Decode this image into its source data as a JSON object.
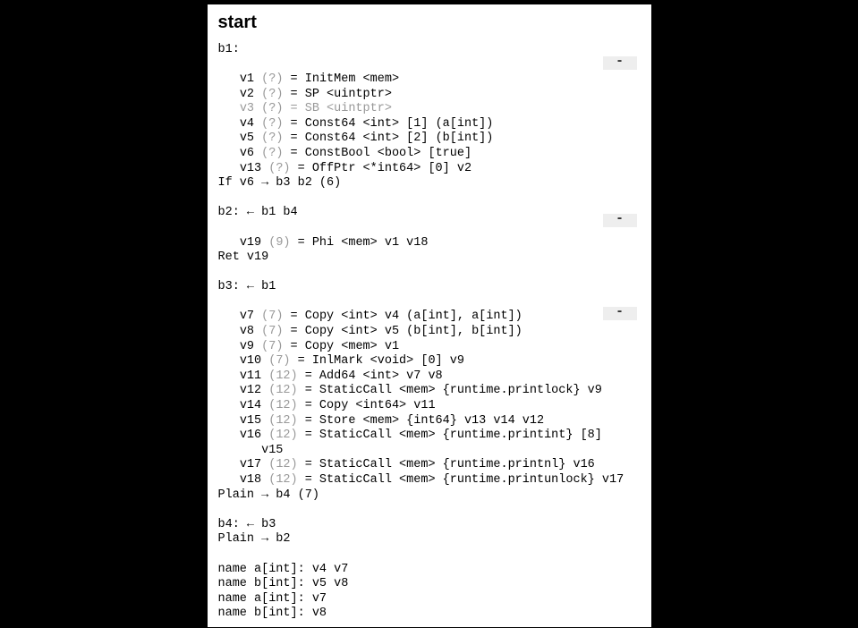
{
  "title": "start",
  "collapse_label": "-",
  "blocks": {
    "b1": {
      "header": "b1:",
      "lines": [
        {
          "indent": "   ",
          "pre": "v1 ",
          "dim": "(?)",
          "post": " = InitMem <mem>"
        },
        {
          "indent": "   ",
          "pre": "v2 ",
          "dim": "(?)",
          "post": " = SP <uintptr>"
        },
        {
          "indent": "   ",
          "pre": "",
          "dim": "v3 (?) = SB <uintptr>",
          "post": ""
        },
        {
          "indent": "   ",
          "pre": "v4 ",
          "dim": "(?)",
          "post": " = Const64 <int> [1] (a[int])"
        },
        {
          "indent": "   ",
          "pre": "v5 ",
          "dim": "(?)",
          "post": " = Const64 <int> [2] (b[int])"
        },
        {
          "indent": "   ",
          "pre": "v6 ",
          "dim": "(?)",
          "post": " = ConstBool <bool> [true]"
        },
        {
          "indent": "   ",
          "pre": "v13 ",
          "dim": "(?)",
          "post": " = OffPtr <*int64> [0] v2"
        }
      ],
      "footer": "If v6 → b3 b2 (6)"
    },
    "b2": {
      "header": "b2: ← b1 b4",
      "lines": [
        {
          "indent": "   ",
          "pre": "v19 ",
          "dim": "(9)",
          "post": " = Phi <mem> v1 v18"
        }
      ],
      "footer": "Ret v19"
    },
    "b3": {
      "header": "b3: ← b1",
      "lines": [
        {
          "indent": "   ",
          "pre": "v7 ",
          "dim": "(7)",
          "post": " = Copy <int> v4 (a[int], a[int])"
        },
        {
          "indent": "   ",
          "pre": "v8 ",
          "dim": "(7)",
          "post": " = Copy <int> v5 (b[int], b[int])"
        },
        {
          "indent": "   ",
          "pre": "v9 ",
          "dim": "(7)",
          "post": " = Copy <mem> v1"
        },
        {
          "indent": "   ",
          "pre": "v10 ",
          "dim": "(7)",
          "post": " = InlMark <void> [0] v9"
        },
        {
          "indent": "   ",
          "pre": "v11 ",
          "dim": "(12)",
          "post": " = Add64 <int> v7 v8"
        },
        {
          "indent": "   ",
          "pre": "v12 ",
          "dim": "(12)",
          "post": " = StaticCall <mem> {runtime.printlock} v9"
        },
        {
          "indent": "   ",
          "pre": "v14 ",
          "dim": "(12)",
          "post": " = Copy <int64> v11"
        },
        {
          "indent": "   ",
          "pre": "v15 ",
          "dim": "(12)",
          "post": " = Store <mem> {int64} v13 v14 v12"
        },
        {
          "indent": "   ",
          "pre": "v16 ",
          "dim": "(12)",
          "post": " = StaticCall <mem> {runtime.printint} [8]"
        },
        {
          "indent": "      ",
          "pre": "v15",
          "dim": "",
          "post": ""
        },
        {
          "indent": "   ",
          "pre": "v17 ",
          "dim": "(12)",
          "post": " = StaticCall <mem> {runtime.printnl} v16"
        },
        {
          "indent": "   ",
          "pre": "v18 ",
          "dim": "(12)",
          "post": " = StaticCall <mem> {runtime.printunlock} v17"
        }
      ],
      "footer": "Plain → b4 (7)"
    },
    "b4": {
      "header": "b4: ← b3",
      "lines": [],
      "footer": "Plain → b2"
    }
  },
  "names": [
    "name a[int]: v4 v7",
    "name b[int]: v5 v8",
    "name a[int]: v7",
    "name b[int]: v8"
  ]
}
